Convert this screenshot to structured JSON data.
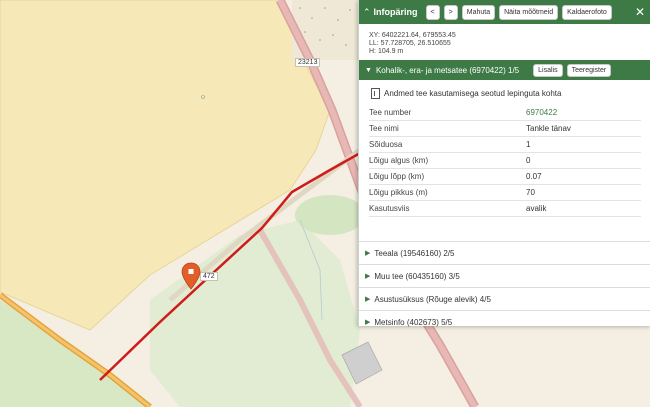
{
  "map": {
    "road_label_1": "23213",
    "road_label_2": "472"
  },
  "panel": {
    "title": "Infopäring",
    "buttons": [
      "<",
      ">",
      "Mahuta",
      "Näita mõõtmeid",
      "Kaldaerofoto"
    ],
    "close_icon": "close-icon",
    "coords": [
      "XY: 6402221.64, 679553.45",
      "LL: 57.728705, 26.510655",
      "H: 104.9 m"
    ],
    "active_section": {
      "title": "Kohalik-, era- ja metsatee (6970422) 1/5",
      "btn_labels": "Lisalis",
      "btn_register": "Teeregister"
    },
    "note": "Andmed tee kasutamisega seotud lepinguta kohta",
    "table": [
      {
        "k": "Tee number",
        "v": "6970422",
        "link": true
      },
      {
        "k": "Tee nimi",
        "v": "Tankle tänav",
        "link": false
      },
      {
        "k": "Sõiduosa",
        "v": "1",
        "link": false
      },
      {
        "k": "Lõigu algus (km)",
        "v": "0",
        "link": false
      },
      {
        "k": "Lõigu lõpp (km)",
        "v": "0.07",
        "link": false
      },
      {
        "k": "Lõigu pikkus (m)",
        "v": "70",
        "link": false
      },
      {
        "k": "Kasutusviis",
        "v": "avalik",
        "link": false
      }
    ],
    "sections": [
      "Teeala (19546160) 2/5",
      "Muu tee (60435160) 3/5",
      "Asustusüksus (Rõuge alevik) 4/5",
      "Metsinfo (402673) 5/5"
    ]
  }
}
